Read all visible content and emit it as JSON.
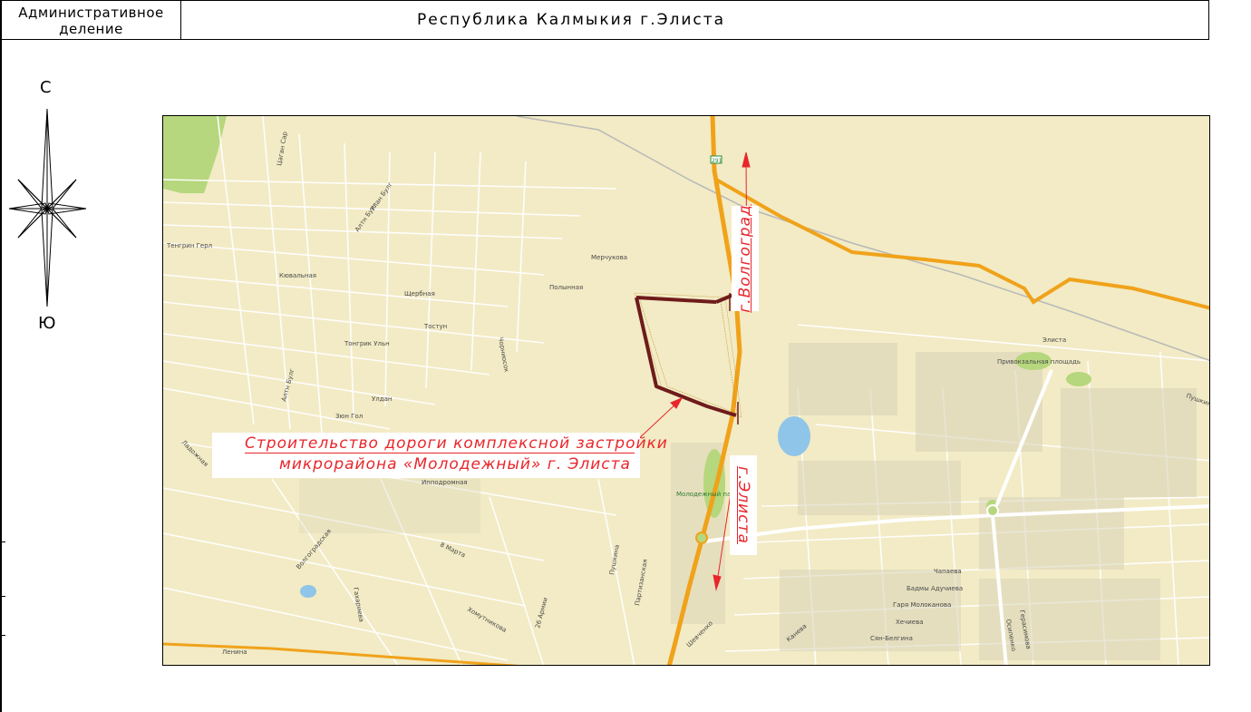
{
  "header": {
    "label": "Административное деление",
    "title": "Республика Калмыкия г.Элиста"
  },
  "compass": {
    "north": "С",
    "south": "Ю"
  },
  "callout": {
    "line1": "Строительство дороги комплексной застройки",
    "line2": "микрорайона «Молодежный» г. Элиста"
  },
  "directions": {
    "to_volgograd": "г.Волгоград",
    "to_elista": "г.Элиста"
  },
  "map": {
    "route_shield": "291",
    "streets": [
      "Цаган Сар",
      "Алтн Булг",
      "Улан Булг",
      "Мерчукова",
      "Полынная",
      "Кювальная",
      "Щербная",
      "Тостун",
      "Тонгрик Ульн",
      "Чорниосок",
      "Алтн Булг",
      "Улдан",
      "Зюн Гол",
      "Ладожная",
      "Ипподромная",
      "Волгоградская",
      "8 Марта",
      "Пушкина",
      "Партизанская",
      "26 Армии",
      "Хомутникова",
      "Гахариева",
      "Ленина",
      "Шевченко",
      "Канева",
      "Сян-Белгина",
      "Хечиева",
      "Гаря Молоканова",
      "Бадмы Адучиева",
      "Чапаева",
      "Осипенко",
      "Герасимова",
      "Пушкинская",
      "Тенгрин Герл"
    ],
    "places": [
      "Элиста",
      "Привокзальная площадь",
      "Молодежный парк"
    ],
    "colors": {
      "background": "#f2ebc5",
      "highway": "#f0a21a",
      "project_outline": "#6e1b1b",
      "water": "#8fc5e8",
      "park": "#b6d77d",
      "annotation": "#e8262b"
    }
  }
}
